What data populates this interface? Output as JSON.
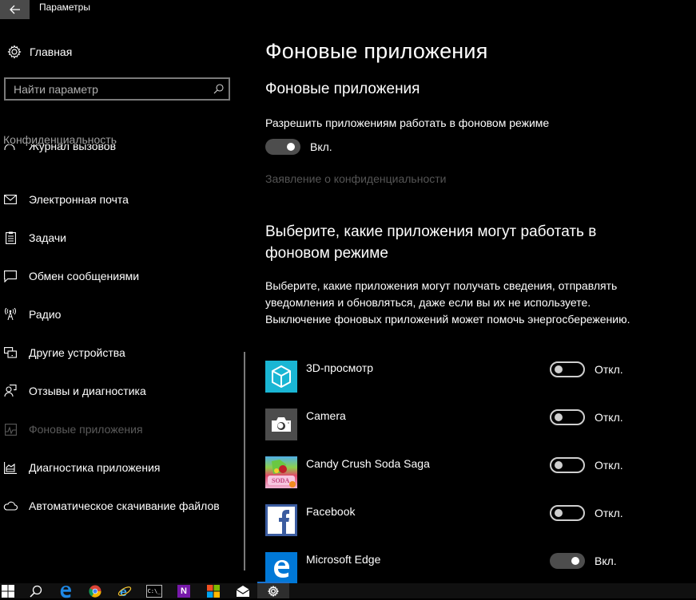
{
  "window": {
    "title": "Параметры",
    "back_label": "Назад"
  },
  "sidebar": {
    "home_label": "Главная",
    "search_placeholder": "Найти параметр",
    "section_label": "Конфиденциальность",
    "clipped_item_label": "Журнал вызовов",
    "items": [
      {
        "label": "Электронная почта",
        "icon": "mail-icon",
        "active": false
      },
      {
        "label": "Задачи",
        "icon": "clipboard-tasks-icon",
        "active": false
      },
      {
        "label": "Обмен сообщениями",
        "icon": "chat-icon",
        "active": false
      },
      {
        "label": "Радио",
        "icon": "radio-tower-icon",
        "active": false
      },
      {
        "label": "Другие устройства",
        "icon": "devices-icon",
        "active": false
      },
      {
        "label": "Отзывы и диагностика",
        "icon": "feedback-icon",
        "active": false
      },
      {
        "label": "Фоновые приложения",
        "icon": "background-apps-icon",
        "active": true
      },
      {
        "label": "Диагностика приложения",
        "icon": "app-diagnostics-icon",
        "active": false
      },
      {
        "label": "Автоматическое скачивание файлов",
        "icon": "cloud-icon",
        "active": false
      }
    ]
  },
  "main": {
    "title": "Фоновые приложения",
    "subheading": "Фоновые приложения",
    "allow_label": "Разрешить приложениям работать в фоновом режиме",
    "allow_toggle": {
      "on": true,
      "state_label": "Вкл."
    },
    "privacy_link": "Заявление о конфиденциальности",
    "choose_heading": "Выберите, какие приложения могут работать в фоновом режиме",
    "description": "Выберите, какие приложения могут получать сведения, отправлять уведомления и обновляться, даже если вы их не используете. Выключение фоновых приложений может помочь энергосбережению.",
    "apps": [
      {
        "name": "3D-просмотр",
        "icon": "3d-viewer-icon",
        "on": false,
        "state_label": "Откл.",
        "color": "#1ab6d4"
      },
      {
        "name": "Camera",
        "icon": "camera-icon",
        "on": false,
        "state_label": "Откл.",
        "color": "#4c4c4c"
      },
      {
        "name": "Candy Crush Soda Saga",
        "icon": "candy-crush-icon",
        "on": false,
        "state_label": "Откл.",
        "color": "#4fb0e8"
      },
      {
        "name": "Facebook",
        "icon": "facebook-icon",
        "on": false,
        "state_label": "Откл.",
        "color": "#3b5ca0"
      },
      {
        "name": "Microsoft Edge",
        "icon": "edge-icon",
        "on": true,
        "state_label": "Вкл.",
        "color": "#0078d7"
      }
    ]
  },
  "taskbar": {
    "items": [
      {
        "name": "start",
        "icon": "windows-start-icon"
      },
      {
        "name": "search",
        "icon": "search-icon"
      },
      {
        "name": "edge",
        "icon": "edge-icon"
      },
      {
        "name": "chrome",
        "icon": "chrome-icon"
      },
      {
        "name": "internet-explorer",
        "icon": "ie-icon"
      },
      {
        "name": "command-prompt",
        "icon": "cmd-icon",
        "text": "C:\\_"
      },
      {
        "name": "onenote",
        "icon": "onenote-icon",
        "text": "N"
      },
      {
        "name": "store",
        "icon": "store-icon"
      },
      {
        "name": "mail",
        "icon": "mail-icon"
      },
      {
        "name": "settings",
        "icon": "settings-gear-icon",
        "active": true
      }
    ]
  }
}
